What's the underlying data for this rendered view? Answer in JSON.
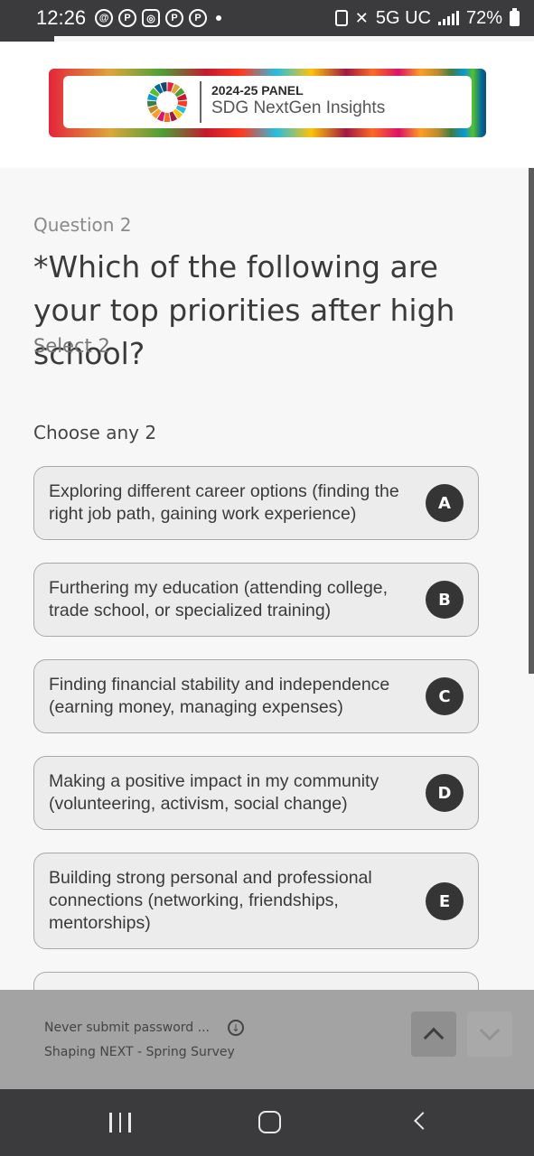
{
  "status_bar": {
    "time": "12:26",
    "network": "5G UC",
    "battery": "72%",
    "notification_icons": [
      "threads-icon",
      "pinterest-icon",
      "instagram-icon",
      "pinterest-icon",
      "pinterest-icon"
    ]
  },
  "header": {
    "logo_line1": "2024-25 PANEL",
    "logo_line2": "SDG NextGen Insights"
  },
  "question": {
    "number_label": "Question 2",
    "title": "*Which of the following are your top priorities after high school?",
    "hint": "Select 2",
    "instruction": "Choose any 2",
    "options": [
      {
        "key": "A",
        "text": "Exploring different career options (finding the right job path, gaining work experience)"
      },
      {
        "key": "B",
        "text": "Furthering my education (attending college, trade school, or specialized training)"
      },
      {
        "key": "C",
        "text": "Finding financial stability and independence (earning money, managing expenses)"
      },
      {
        "key": "D",
        "text": "Making a positive impact in my community (volunteering, activism, social change)"
      },
      {
        "key": "E",
        "text": "Building strong personal and professional connections (networking, friendships, mentorships)"
      }
    ]
  },
  "footer": {
    "warning": "Never submit password ...",
    "survey_name": "Shaping NEXT - Spring Survey"
  },
  "colors": {
    "key_badge": "#353535",
    "option_bg": "#ececec",
    "footer_bg": "#a3a3a3",
    "system_bar": "#3b3b3d"
  }
}
